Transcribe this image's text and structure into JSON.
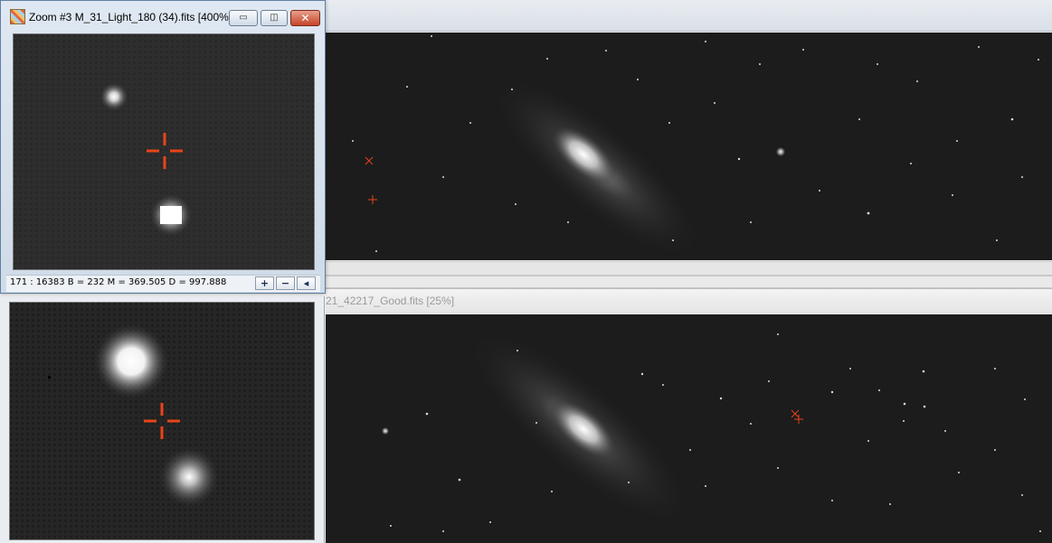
{
  "zoom_window": {
    "title": "Zoom #3 M_31_Light_180 (34).fits  [400%]",
    "status_text": "171 : 16383    B = 232  M = 369.505  D = 997.888",
    "buttons": {
      "minimize": "▭",
      "maximize": "◫",
      "close": "✕",
      "zoom_in": "+",
      "zoom_out": "−",
      "scroll_left": "◂"
    }
  },
  "second_image_window": {
    "title": "21_42217_Good.fits  [25%]"
  },
  "icons": [
    "app-icon",
    "minimize-icon",
    "maximize-icon",
    "close-icon",
    "zoom-in-icon",
    "zoom-out-icon",
    "scroll-left-icon",
    "crosshair-icon"
  ],
  "colors": {
    "crosshair": "#e8441a",
    "sky": "#1c1c1c",
    "close_button": "#c7432a"
  }
}
